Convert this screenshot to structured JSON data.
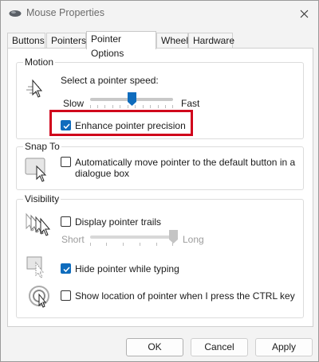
{
  "window": {
    "title": "Mouse Properties",
    "close_icon": "close-icon"
  },
  "tabs": [
    {
      "label": "Buttons",
      "active": false
    },
    {
      "label": "Pointers",
      "active": false
    },
    {
      "label": "Pointer Options",
      "active": true
    },
    {
      "label": "Wheel",
      "active": false
    },
    {
      "label": "Hardware",
      "active": false
    }
  ],
  "motion": {
    "group_label": "Motion",
    "speed_prompt": "Select a pointer speed:",
    "slow_label": "Slow",
    "fast_label": "Fast",
    "speed_fraction": 0.5,
    "enhance_precision_label": "Enhance pointer precision",
    "enhance_precision_checked": true
  },
  "snap_to": {
    "group_label": "Snap To",
    "auto_move_label_line1": "Automatically move pointer to the default button in a",
    "auto_move_label_line2": "dialogue box",
    "auto_move_checked": false
  },
  "visibility": {
    "group_label": "Visibility",
    "trails_label": "Display pointer trails",
    "trails_checked": false,
    "short_label": "Short",
    "long_label": "Long",
    "trails_fraction": 1.0,
    "hide_typing_label": "Hide pointer while typing",
    "hide_typing_checked": true,
    "show_location_label": "Show location of pointer when I press the CTRL key",
    "show_location_checked": false
  },
  "footer": {
    "ok_label": "OK",
    "cancel_label": "Cancel",
    "apply_label": "Apply"
  },
  "colors": {
    "accent": "#0f6cbd",
    "highlight_box": "#d0021b",
    "window_bg": "#f3f3f3"
  }
}
